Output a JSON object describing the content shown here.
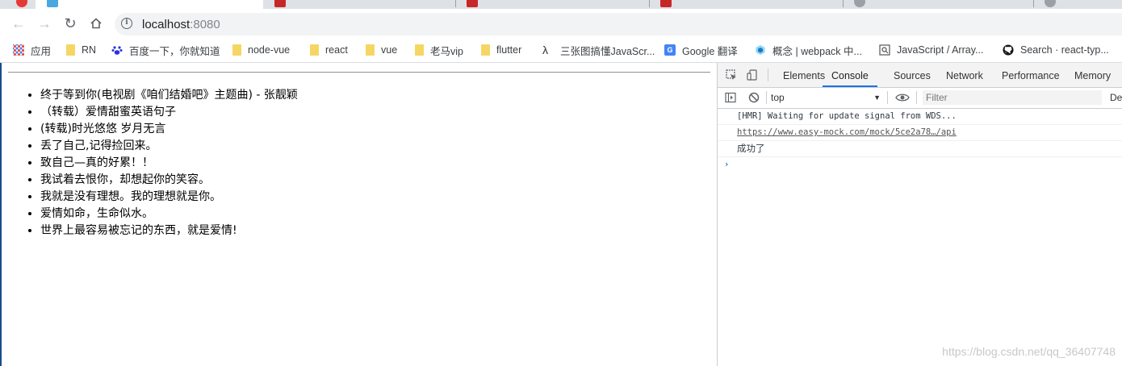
{
  "browser": {
    "tabs": [
      {
        "title": ""
      },
      {
        "title": ""
      },
      {
        "title": ""
      },
      {
        "title": ""
      },
      {
        "title": ""
      },
      {
        "title": ""
      },
      {
        "title": ""
      }
    ],
    "address": {
      "host": "localhost",
      "port": ":8080"
    }
  },
  "bookmarks": [
    {
      "label": "应用",
      "icon": "apps-grid-icon"
    },
    {
      "label": "RN",
      "icon": "folder-icon"
    },
    {
      "label": "百度一下，你就知道",
      "icon": "baidu-paw-icon"
    },
    {
      "label": "node-vue",
      "icon": "folder-icon"
    },
    {
      "label": "react",
      "icon": "folder-icon"
    },
    {
      "label": "vue",
      "icon": "folder-icon"
    },
    {
      "label": "老马vip",
      "icon": "folder-icon"
    },
    {
      "label": "flutter",
      "icon": "folder-icon"
    },
    {
      "label": "三张图搞懂JavaScr...",
      "icon": "js-lambda-icon"
    },
    {
      "label": "Google 翻译",
      "icon": "google-translate-icon"
    },
    {
      "label": "概念 | webpack 中...",
      "icon": "webpack-icon"
    },
    {
      "label": "JavaScript / Array...",
      "icon": "search-page-icon"
    },
    {
      "label": "Search · react-typ...",
      "icon": "github-icon"
    }
  ],
  "page": {
    "items": [
      "终于等到你(电视剧《咱们结婚吧》主题曲) - 张靓颖",
      "（转载）爱情甜蜜英语句子",
      "(转载)时光悠悠 岁月无言",
      "丢了自己,记得捡回来。",
      "致自己—真的好累！！",
      "我试着去恨你，却想起你的笑容。",
      "我就是没有理想。我的理想就是你。",
      "爱情如命，生命似水。",
      "世界上最容易被忘记的东西，就是爱情!"
    ]
  },
  "devtools": {
    "tabs": [
      "Elements",
      "Console",
      "Sources",
      "Network",
      "Performance",
      "Memory"
    ],
    "active_tab": "Console",
    "context": "top",
    "filter_placeholder": "Filter",
    "levels_label": "De",
    "console": {
      "hmr": "[HMR] Waiting for update signal from WDS...",
      "link": "https://www.easy-mock.com/mock/5ce2a78…/api",
      "success": "成功了",
      "prompt": "›"
    }
  },
  "watermark": "https://blog.csdn.net/qq_36407748",
  "colors": {
    "accent": "#1a73e8",
    "folder": "#f6d663",
    "left_border": "#1a4c8b"
  }
}
